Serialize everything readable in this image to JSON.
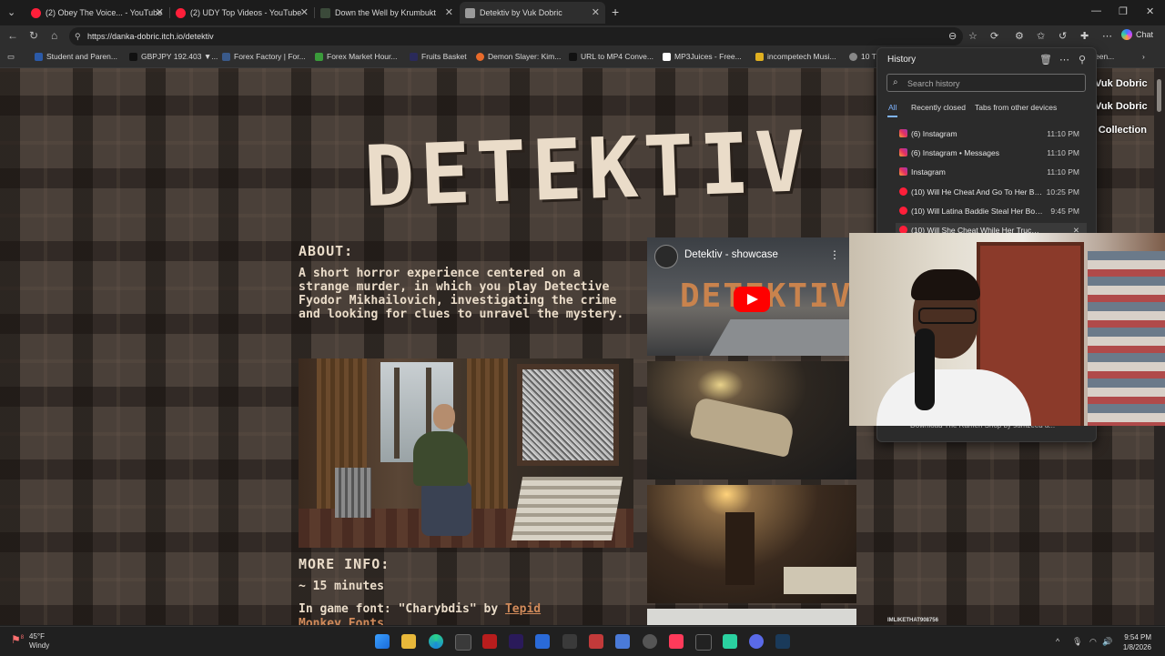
{
  "tabs": [
    {
      "label": "(2) Obey The Voice... - YouTube",
      "favicon": "youtube-icon"
    },
    {
      "label": "(2) UDY Top Videos - YouTube",
      "favicon": "youtube-icon"
    },
    {
      "label": "Down the Well by Krumbukt",
      "favicon": "itch-icon"
    },
    {
      "label": "Detektiv by Vuk Dobric",
      "favicon": "page-icon",
      "active": true
    }
  ],
  "address": {
    "url": "https://danka-dobric.itch.io/detektiv"
  },
  "chat_label": "Chat",
  "bookmarks": [
    "Student and Paren...",
    "GBPJPY 192.403 ▼...",
    "Forex Factory | For...",
    "Forex Market Hour...",
    "Fruits Basket",
    "Demon Slayer: Kim...",
    "URL to MP4 Conve...",
    "MP3Juices - Free...",
    "incompetech Musi...",
    "10 T",
    "een..."
  ],
  "page": {
    "title": "DETEKTIV",
    "about_heading": "ABOUT:",
    "about_text": "A short horror experience centered on a strange murder, in which you play Detective Fyodor Mikhailovich, investigating the crime and looking for clues to unravel the mystery.",
    "more_info_heading": "MORE INFO:",
    "duration": "~ 15  minutes",
    "font_prefix": "In game font: \"Charybdis\" by ",
    "font_link": "Tepid",
    "font_link_2": "Monkey Fonts",
    "video_title": "Detektiv - showcase",
    "video_logo": "DETEKTIV",
    "creator_links": [
      "Vuk Dobric",
      "Vuk Dobric",
      "o Collection"
    ]
  },
  "history": {
    "title": "History",
    "search_placeholder": "Search history",
    "tabs": [
      "All",
      "Recently closed",
      "Tabs from other devices"
    ],
    "items": [
      {
        "title": "(6) Instagram",
        "time": "11:10 PM",
        "icon": "instagram-icon"
      },
      {
        "title": "(6) Instagram • Messages",
        "time": "11:10 PM",
        "icon": "instagram-icon"
      },
      {
        "title": "Instagram",
        "time": "11:10 PM",
        "icon": "instagram-icon"
      },
      {
        "title": "(10) Will He Cheat And Go To Her BEDR...",
        "time": "10:25 PM",
        "icon": "youtube-icon"
      },
      {
        "title": "(10) Will Latina Baddie Steal Her Boyfrien...",
        "time": "9:45 PM",
        "icon": "youtube-icon"
      },
      {
        "title": "(10) Will She Cheat While Her Trucker Bo...",
        "time": "",
        "icon": "youtube-icon"
      }
    ],
    "bottom_item": "Download The Ramen Shop by sumzeed a..."
  },
  "watermark": "IMLIKETHAT908756",
  "taskbar": {
    "weather_temp": "45°F",
    "weather_desc": "Windy",
    "weather_badge": "8",
    "time": "9:54 PM",
    "date": "1/8/2026"
  }
}
